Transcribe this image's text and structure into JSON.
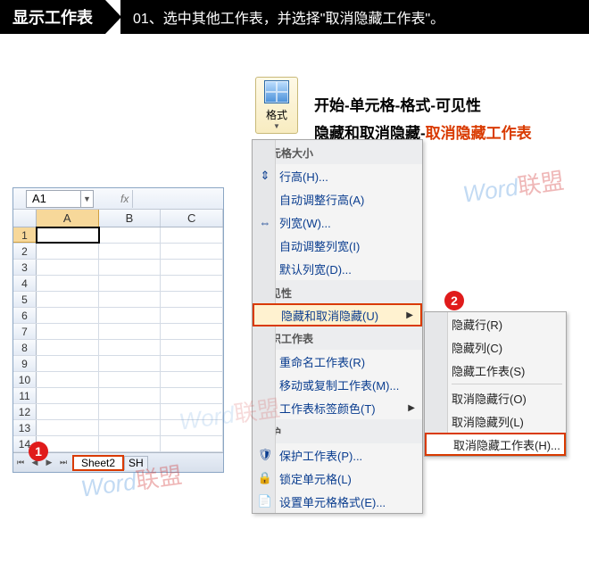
{
  "header": {
    "title": "显示工作表",
    "step": "01、选中其他工作表，并选择\"取消隐藏工作表\"。"
  },
  "format_btn": {
    "label": "格式"
  },
  "breadcrumb": {
    "row1": "开始-单元格-格式-可见性",
    "row2a": "隐藏和取消隐藏-",
    "row2b": "取消隐藏工作表"
  },
  "excel": {
    "namebox": "A1",
    "cols": [
      "A",
      "B",
      "C"
    ],
    "rows": [
      "1",
      "2",
      "3",
      "4",
      "5",
      "6",
      "7",
      "8",
      "9",
      "10",
      "11",
      "12",
      "13",
      "14"
    ],
    "tab1": "Sheet2",
    "tab2": "SH"
  },
  "menu1": {
    "s1": "单元格大小",
    "i1": "行高(H)...",
    "i2": "自动调整行高(A)",
    "i3": "列宽(W)...",
    "i4": "自动调整列宽(I)",
    "i5": "默认列宽(D)...",
    "s2": "可见性",
    "i6": "隐藏和取消隐藏(U)",
    "s3": "组织工作表",
    "i7": "重命名工作表(R)",
    "i8": "移动或复制工作表(M)...",
    "i9": "工作表标签颜色(T)",
    "s4": "保护",
    "i10": "保护工作表(P)...",
    "i11": "锁定单元格(L)",
    "i12": "设置单元格格式(E)..."
  },
  "menu2": {
    "i1": "隐藏行(R)",
    "i2": "隐藏列(C)",
    "i3": "隐藏工作表(S)",
    "i4": "取消隐藏行(O)",
    "i5": "取消隐藏列(L)",
    "i6": "取消隐藏工作表(H)..."
  },
  "markers": {
    "m1": "1",
    "m2": "2"
  },
  "watermark": {
    "a": "W",
    "b": "ord",
    "c": "联盟"
  }
}
